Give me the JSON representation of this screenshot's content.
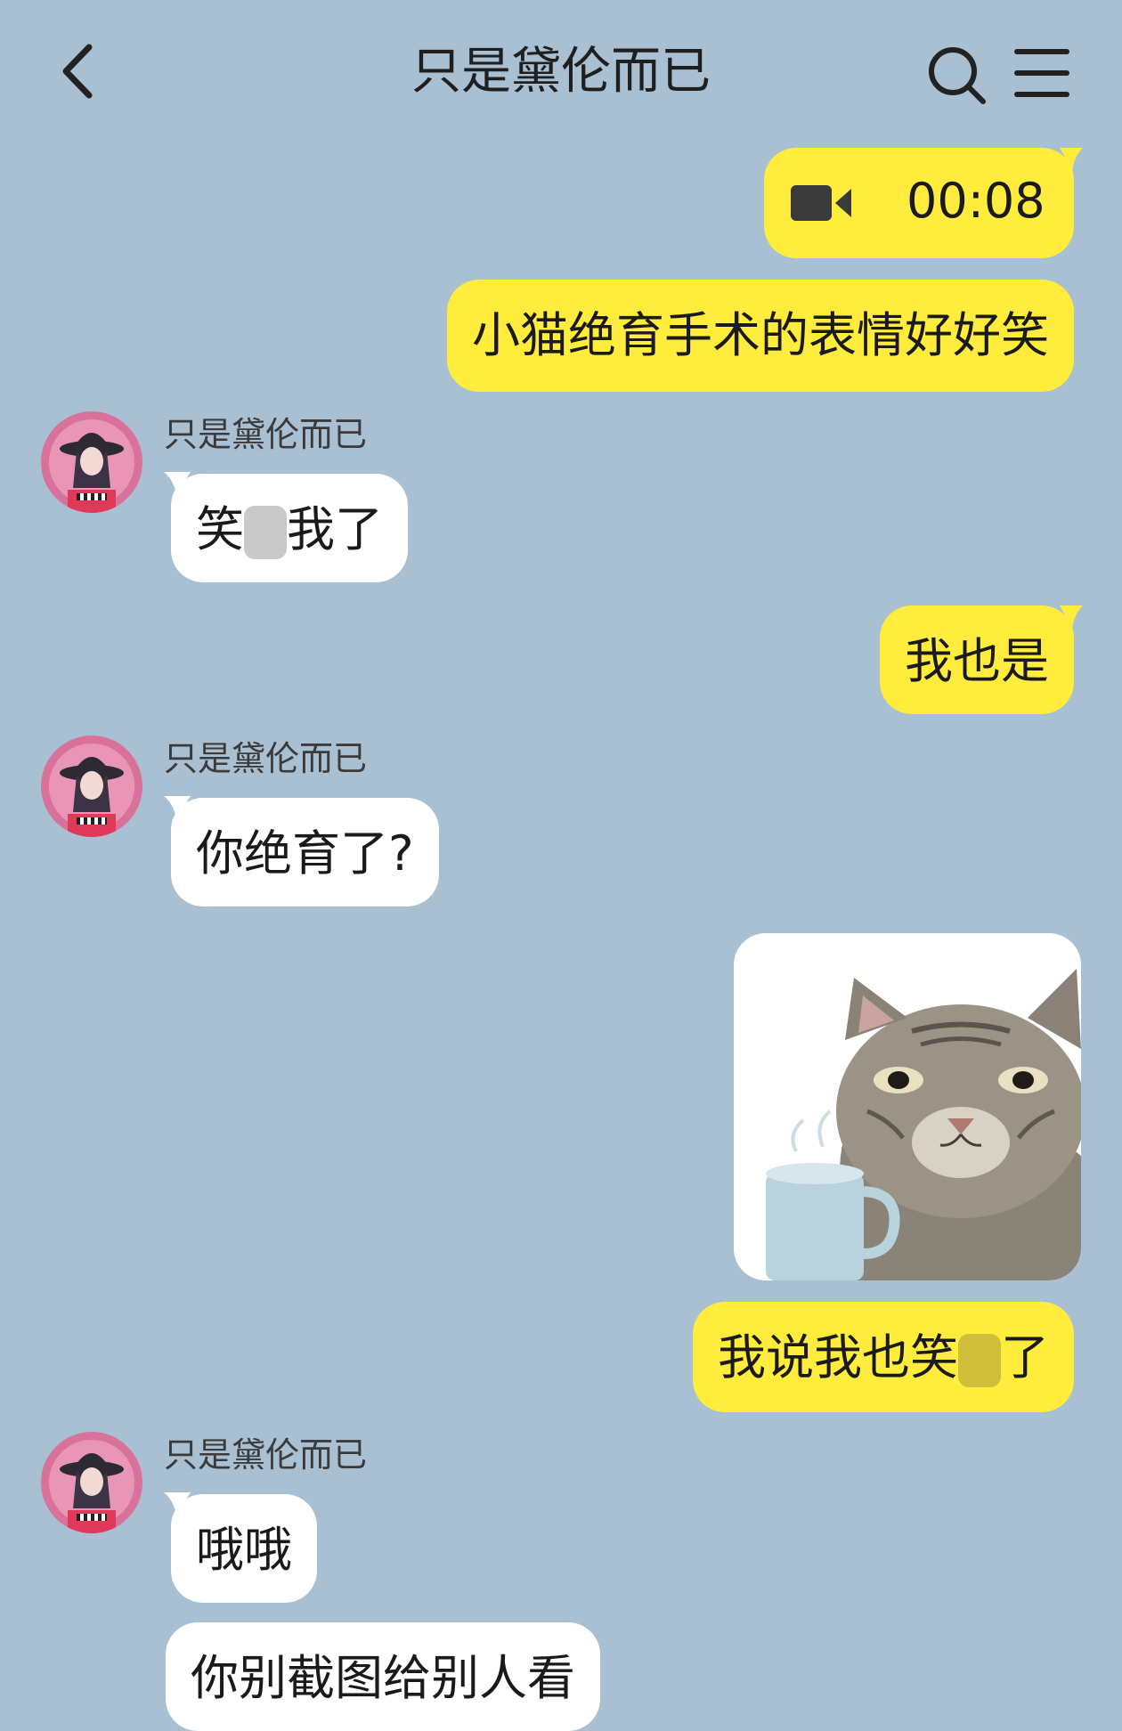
{
  "header": {
    "title": "只是黛伦而已",
    "back_icon": "chevron-left-icon",
    "search_icon": "search-icon",
    "menu_icon": "menu-icon"
  },
  "colors": {
    "background": "#a9bfd2",
    "outgoing_bubble": "#ffec3d",
    "incoming_bubble": "#ffffff"
  },
  "messages": [
    {
      "direction": "out",
      "type": "video",
      "duration": "00:08"
    },
    {
      "direction": "out",
      "type": "text",
      "text": "小猫绝育手术的表情好好笑"
    },
    {
      "direction": "in",
      "sender": "只是黛伦而已",
      "type": "text",
      "text_before": "笑",
      "text_after": "我了"
    },
    {
      "direction": "out",
      "type": "text",
      "text": "我也是"
    },
    {
      "direction": "in",
      "sender": "只是黛伦而已",
      "type": "text",
      "text": "你绝育了?"
    },
    {
      "direction": "out",
      "type": "sticker",
      "sticker": "cat-with-cup"
    },
    {
      "direction": "out",
      "type": "text",
      "text_before": "我说我也笑",
      "text_after": "了"
    },
    {
      "direction": "in",
      "sender": "只是黛伦而已",
      "type": "text",
      "text": "哦哦"
    },
    {
      "direction": "in",
      "type": "text",
      "text": "你别截图给别人看"
    }
  ]
}
